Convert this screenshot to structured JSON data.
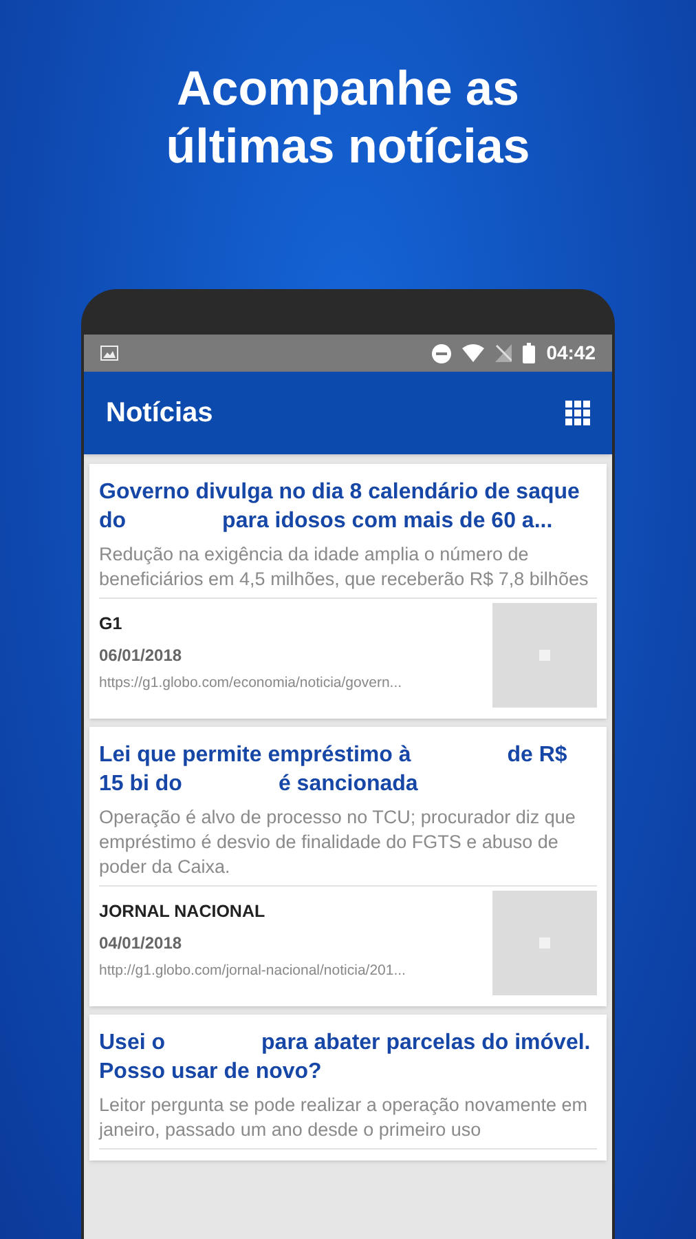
{
  "headline": "Acompanhe as últimas notícias",
  "status_bar": {
    "time": "04:42"
  },
  "app_bar": {
    "title": "Notícias"
  },
  "articles": [
    {
      "title_parts": [
        "Governo divulga no dia 8 calendário de saque do",
        "para idosos com mais de 60 a..."
      ],
      "summary": "Redução na exigência da idade amplia o número de beneficiários em 4,5 milhões, que receberão R$ 7,8 bilhões",
      "source": "G1",
      "date": "06/01/2018",
      "url": "https://g1.globo.com/economia/noticia/govern..."
    },
    {
      "title_parts": [
        "Lei que permite empréstimo à",
        "de R$ 15 bi do",
        "é sancionada"
      ],
      "summary": "Operação é alvo de processo no TCU; procurador diz que empréstimo é desvio de finalidade do FGTS e abuso de poder da Caixa.",
      "source": "JORNAL NACIONAL",
      "date": "04/01/2018",
      "url": "http://g1.globo.com/jornal-nacional/noticia/201..."
    },
    {
      "title_parts": [
        "Usei o",
        "para abater parcelas do imóvel. Posso usar de novo?"
      ],
      "summary": "Leitor pergunta se pode realizar a operação novamente em janeiro, passado um ano desde o primeiro uso"
    }
  ]
}
